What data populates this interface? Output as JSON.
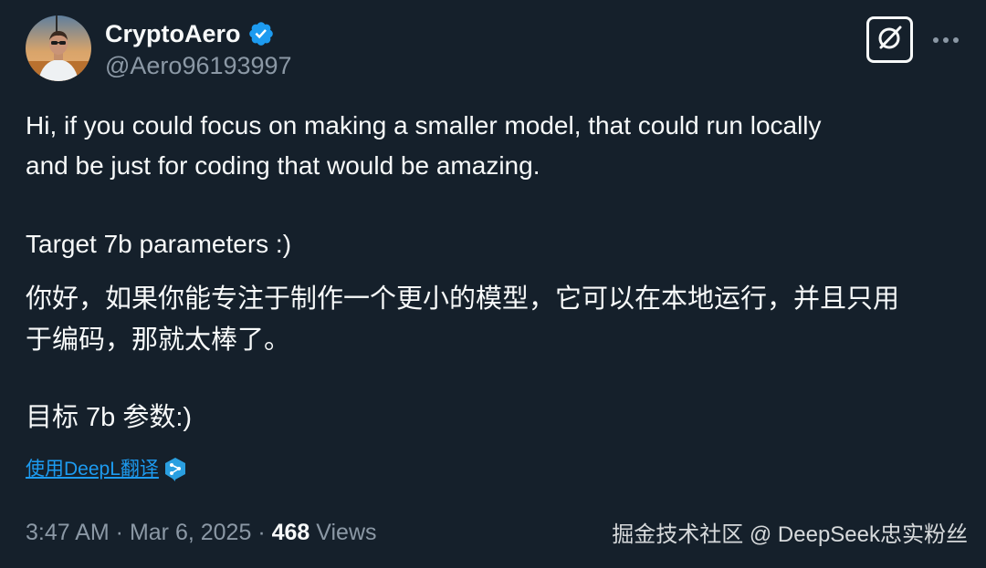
{
  "author": {
    "display_name": "CryptoAero",
    "handle": "@Aero96193997",
    "verified": true
  },
  "tweet": {
    "lines": [
      "Hi, if you could focus on making a smaller model, that could run locally",
      "and be just for coding that would be amazing.",
      "Target 7b parameters :)",
      "你好，如果你能专注于制作一个更小的模型，它可以在本地运行，并且只用",
      "于编码，那就太棒了。",
      "目标 7b 参数:)"
    ]
  },
  "translate_link": "使用DeepL翻译",
  "meta": {
    "time": "3:47 AM",
    "separator": " · ",
    "date": "Mar 6, 2025",
    "views_count": "468",
    "views_label": "Views"
  },
  "watermark": "掘金技术社区 @ DeepSeek忠实粉丝",
  "icons": {
    "verified": "verified-badge-icon",
    "grok": "grok-icon",
    "more": "more-icon",
    "deepl": "deepl-icon"
  },
  "colors": {
    "background": "#15202b",
    "text_primary": "#f7f9f9",
    "text_secondary": "#8b98a5",
    "accent": "#1d9bf0"
  }
}
